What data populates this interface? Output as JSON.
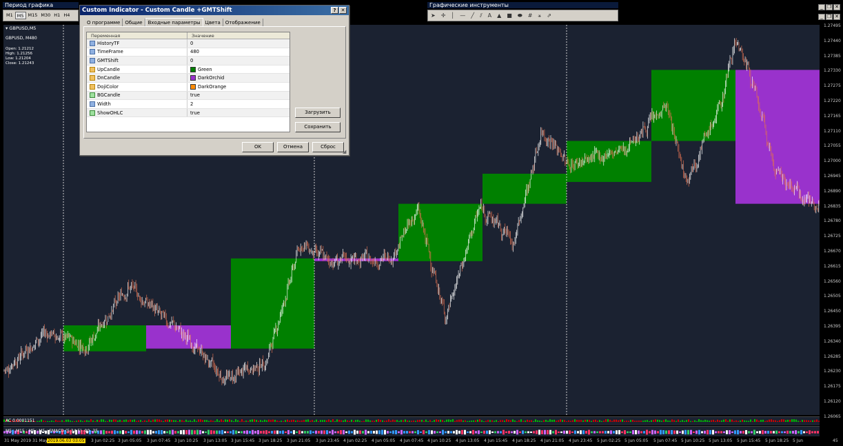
{
  "top": {
    "period_title": "Период графика",
    "periods": [
      "M1",
      "M5",
      "M15",
      "M30",
      "H1",
      "H4"
    ],
    "active_period": "M5",
    "tools_title": "Графические инструменты"
  },
  "chart": {
    "symbol_label": "▾ GBPUSD,M5",
    "info_symbol": "GBPUSD, M480",
    "ohlc": [
      "Open:  1.21212",
      "High:   1.21256",
      "Low:   1.21204",
      "Close:  1.21243"
    ],
    "colors": {
      "bg": "#1b2231",
      "up_box": "#008000",
      "dn_box": "#9932cc",
      "bull_candle": "#ffffff",
      "bear_candle": "#e07050"
    },
    "y_ticks": [
      "1.27495",
      "1.27440",
      "1.27385",
      "1.27330",
      "1.27275",
      "1.27220",
      "1.27165",
      "1.27110",
      "1.27055",
      "1.27000",
      "1.26945",
      "1.26890",
      "1.26835",
      "1.26780",
      "1.26725",
      "1.26670",
      "1.26615",
      "1.26560",
      "1.26505",
      "1.26450",
      "1.26395",
      "1.26340",
      "1.26285",
      "1.26230",
      "1.26175",
      "1.26120",
      "1.26065"
    ],
    "x_ticks": [
      "31 May 2019",
      "31 May",
      "3 Jun 02:25",
      "3 Jun 05:05",
      "3 Jun 07:45",
      "3 Jun 10:25",
      "3 Jun 13:05",
      "3 Jun 15:45",
      "3 Jun 18:25",
      "3 Jun 21:05",
      "3 Jun 23:45",
      "4 Jun 02:25",
      "4 Jun 05:05",
      "4 Jun 07:45",
      "4 Jun 10:25",
      "4 Jun 13:05",
      "4 Jun 15:45",
      "4 Jun 18:25",
      "4 Jun 21:05",
      "4 Jun 23:45",
      "5 Jun 02:25",
      "5 Jun 05:05",
      "5 Jun 07:45",
      "5 Jun 10:25",
      "5 Jun 13:05",
      "5 Jun 15:45",
      "5 Jun 18:25",
      "5 Jun"
    ],
    "x_highlight": "2019.06.03 03:05",
    "x_right_fragment": "45"
  },
  "sub1": {
    "label": "AC 0.0001151"
  },
  "sub2": {
    "label": "M5 ; M15 ; M5 ; M5 ; SMACD (5,34,5) -90.-35"
  },
  "dialog": {
    "title": "Custom Indicator - Custom Candle +GMTShift",
    "help": "?",
    "close": "✕",
    "tabs": [
      "О программе",
      "Общие",
      "Входные параметры",
      "Цвета",
      "Отображение"
    ],
    "active_tab": 2,
    "col_var": "Переменная",
    "col_val": "Значение",
    "params": [
      {
        "name": "HistoryTF",
        "value": "0",
        "type": "num"
      },
      {
        "name": "TimeFrame",
        "value": "480",
        "type": "num"
      },
      {
        "name": "GMTShift",
        "value": "0",
        "type": "num"
      },
      {
        "name": "UpCandle",
        "value": "Green",
        "type": "col",
        "swatch": "#008000"
      },
      {
        "name": "DnCandle",
        "value": "DarkOrchid",
        "type": "col",
        "swatch": "#9932cc"
      },
      {
        "name": "DojiColor",
        "value": "DarkOrange",
        "type": "col",
        "swatch": "#ff8c00"
      },
      {
        "name": "BGCandle",
        "value": "true",
        "type": "bool"
      },
      {
        "name": "Width",
        "value": "2",
        "type": "num"
      },
      {
        "name": "ShowOHLC",
        "value": "true",
        "type": "bool"
      }
    ],
    "load_btn": "Загрузить",
    "save_btn": "Сохранить",
    "ok_btn": "OK",
    "cancel_btn": "Отмена",
    "reset_btn": "Сброс"
  }
}
